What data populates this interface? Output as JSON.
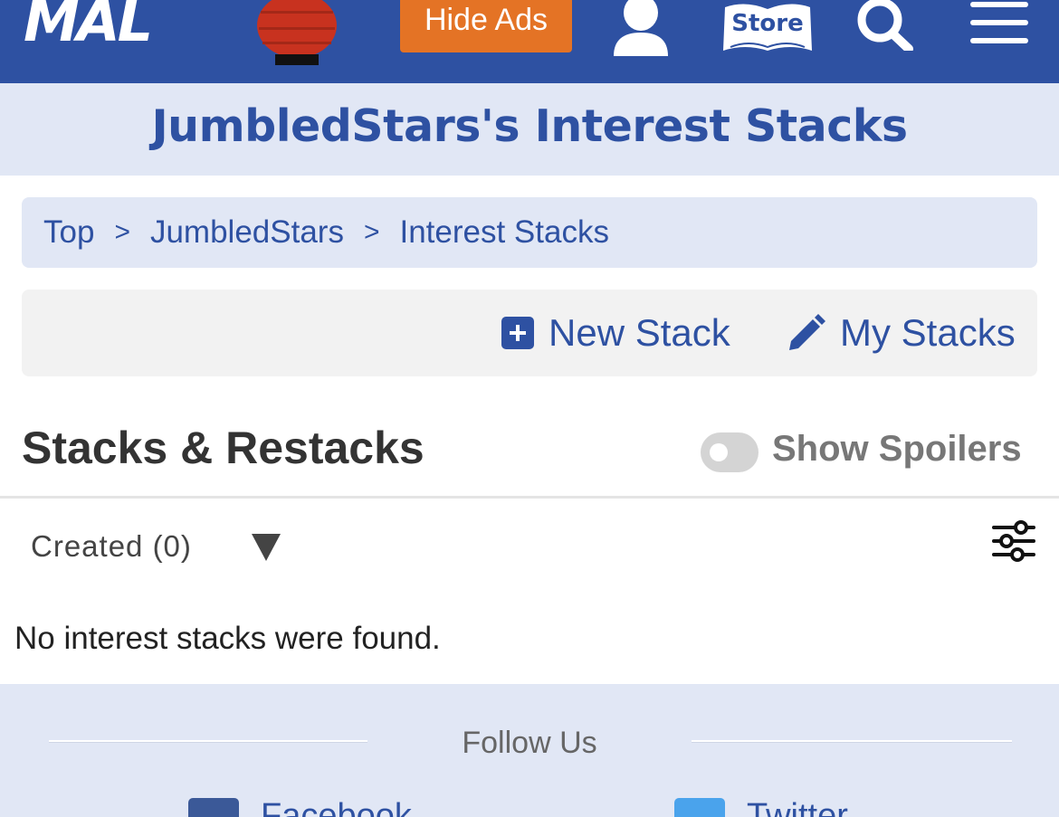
{
  "topbar": {
    "logo": "MAL",
    "hide_ads": "Hide Ads",
    "store_label": "Store",
    "icons": [
      "lantern-icon",
      "user-icon",
      "store-icon",
      "search-icon",
      "menu-icon"
    ],
    "brand_color": "#2e51a2",
    "ads_color": "#e47325"
  },
  "page": {
    "title": "JumbledStars's Interest Stacks"
  },
  "breadcrumb": {
    "items": [
      "Top",
      "JumbledStars",
      "Interest Stacks"
    ],
    "separator": ">"
  },
  "actions": {
    "new_stack": "New Stack",
    "my_stacks": "My Stacks"
  },
  "section": {
    "title": "Stacks & Restacks",
    "spoiler_label": "Show Spoilers",
    "spoilers_on": false
  },
  "filter": {
    "selected": "Created (0)"
  },
  "results": {
    "empty_message": "No interest stacks were found."
  },
  "footer": {
    "follow_label": "Follow Us",
    "social": [
      "Facebook",
      "Twitter"
    ]
  }
}
